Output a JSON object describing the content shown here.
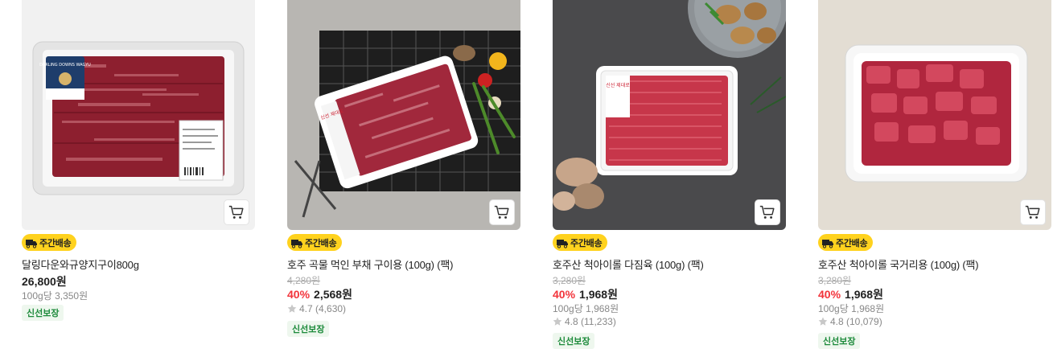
{
  "products": [
    {
      "badge": "주간배송",
      "name": "달링다운와규양지구이800g",
      "original_price": "",
      "discount": "",
      "price": "26,800원",
      "unit_price": "100g당 3,350원",
      "rating": "",
      "tag": "신선보장",
      "image_label": "DARLING DOWNS WAGYU"
    },
    {
      "badge": "주간배송",
      "name": "호주 곡물 먹인 부채 구이용 (100g) (팩)",
      "original_price": "4,280원",
      "discount": "40%",
      "price": "2,568원",
      "unit_price": "",
      "rating": "4.7 (4,630)",
      "tag": "신선보장",
      "image_label": "신선 제대로"
    },
    {
      "badge": "주간배송",
      "name": "호주산 척아이롤 다짐육 (100g) (팩)",
      "original_price": "3,280원",
      "discount": "40%",
      "price": "1,968원",
      "unit_price": "100g당 1,968원",
      "rating": "4.8 (11,233)",
      "tag": "신선보장",
      "image_label": "신선 제대로"
    },
    {
      "badge": "주간배송",
      "name": "호주산 척아이롤 국거리용 (100g) (팩)",
      "original_price": "3,280원",
      "discount": "40%",
      "price": "1,968원",
      "unit_price": "100g당 1,968원",
      "rating": "4.8 (10,079)",
      "tag": "신선보장",
      "image_label": ""
    }
  ],
  "colors": {
    "badge_bg": "#ffd21e",
    "discount": "#f2343b",
    "fresh_text": "#1c8a3a",
    "fresh_bg": "#eef7ee"
  },
  "icons": {
    "cart": "cart-icon",
    "truck": "truck-icon",
    "star": "star-icon"
  }
}
